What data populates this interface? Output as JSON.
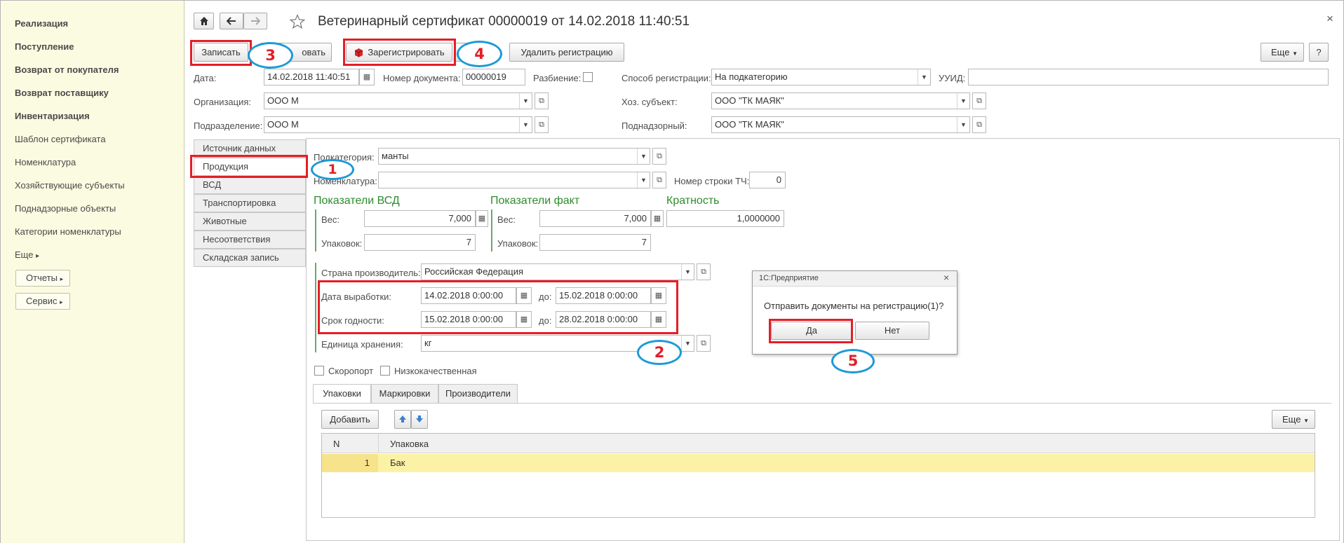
{
  "sidebar": {
    "items": [
      {
        "label": "Реализация",
        "bold": true
      },
      {
        "label": "Поступление",
        "bold": true
      },
      {
        "label": "Возврат от покупателя",
        "bold": true
      },
      {
        "label": "Возврат поставщику",
        "bold": true
      },
      {
        "label": "Инвентаризация",
        "bold": true
      },
      {
        "label": "Шаблон сертификата",
        "bold": false
      },
      {
        "label": "Номенклатура",
        "bold": false
      },
      {
        "label": "Хозяйствующие субъекты",
        "bold": false
      },
      {
        "label": "Поднадзорные объекты",
        "bold": false
      },
      {
        "label": "Категории номенклатуры",
        "bold": false
      },
      {
        "label": "Еще",
        "bold": false
      }
    ],
    "more_arrow": "▸",
    "reports_label": "Отчеты",
    "service_label": "Сервис"
  },
  "window": {
    "title": "Ветеринарный сертификат 00000019 от 14.02.2018 11:40:51",
    "close": "×"
  },
  "toolbar": {
    "save": "Записать",
    "print_partial": "овать",
    "register": "Зарегистрировать",
    "delete_registration": "Удалить регистрацию",
    "more": "Еще",
    "help": "?"
  },
  "header_fields": {
    "date_label": "Дата:",
    "date_value": "14.02.2018 11:40:51",
    "doc_number_label": "Номер документа:",
    "doc_number_value": "00000019",
    "split_label": "Разбиение:",
    "reg_method_label": "Способ регистрации:",
    "reg_method_value": "На подкатегорию",
    "uuid_label": "УУИД:",
    "uuid_value": "",
    "org_label": "Организация:",
    "org_value": "ООО М",
    "econ_subject_label": "Хоз. субъект:",
    "econ_subject_value": "ООО \"ТК МАЯК\"",
    "dept_label": "Подразделение:",
    "dept_value": "ООО М",
    "supervised_label": "Поднадзорный:",
    "supervised_value": "ООО \"ТК МАЯК\""
  },
  "tabs": [
    "Источник данных",
    "Продукция",
    "ВСД",
    "Транспортировка",
    "Животные",
    "Несоответствия",
    "Складская запись"
  ],
  "product": {
    "subcategory_label": "Подкатегория:",
    "subcategory_value": "манты",
    "nomenclature_label": "Номенклатура:",
    "nomenclature_value": "",
    "row_number_label": "Номер строки ТЧ:",
    "row_number_value": "0",
    "vsd_group": "Показатели ВСД",
    "fact_group": "Показатели факт",
    "multiplicity_group": "Кратность",
    "weight_label": "Вес:",
    "packages_label": "Упаковок:",
    "vsd_weight": "7,000",
    "vsd_packages": "7",
    "fact_weight": "7,000",
    "fact_packages": "7",
    "multiplicity_value": "1,0000000",
    "country_label": "Страна производитель:",
    "country_value": "Российская Федерация",
    "production_date_label": "Дата выработки:",
    "production_from": "14.02.2018  0:00:00",
    "production_to": "15.02.2018  0:00:00",
    "expiry_label": "Срок годности:",
    "expiry_from": "15.02.2018  0:00:00",
    "expiry_to": "28.02.2018  0:00:00",
    "to_label": "до:",
    "unit_label": "Единица хранения:",
    "unit_value": "кг",
    "perishable_label": "Скоропорт",
    "low_quality_label": "Низкокачественная"
  },
  "subtabs": [
    "Упаковки",
    "Маркировки",
    "Производители"
  ],
  "table": {
    "add_label": "Добавить",
    "more_label": "Еще",
    "col_n": "N",
    "col_package": "Упаковка",
    "rows": [
      {
        "n": "1",
        "package": "Бак"
      }
    ]
  },
  "dialog": {
    "title": "1С:Предприятие",
    "close": "×",
    "message": "Отправить документы на регистрацию(1)?",
    "yes": "Да",
    "no": "Нет"
  },
  "markers": [
    "1",
    "2",
    "3",
    "4",
    "5"
  ],
  "colors": {
    "annotation_red": "#e41e26",
    "annotation_blue": "#1c9ad6",
    "sidebar_bg": "#fbfbe1",
    "group_green": "#2c8c2c",
    "selected_row": "#fbf2a5"
  }
}
